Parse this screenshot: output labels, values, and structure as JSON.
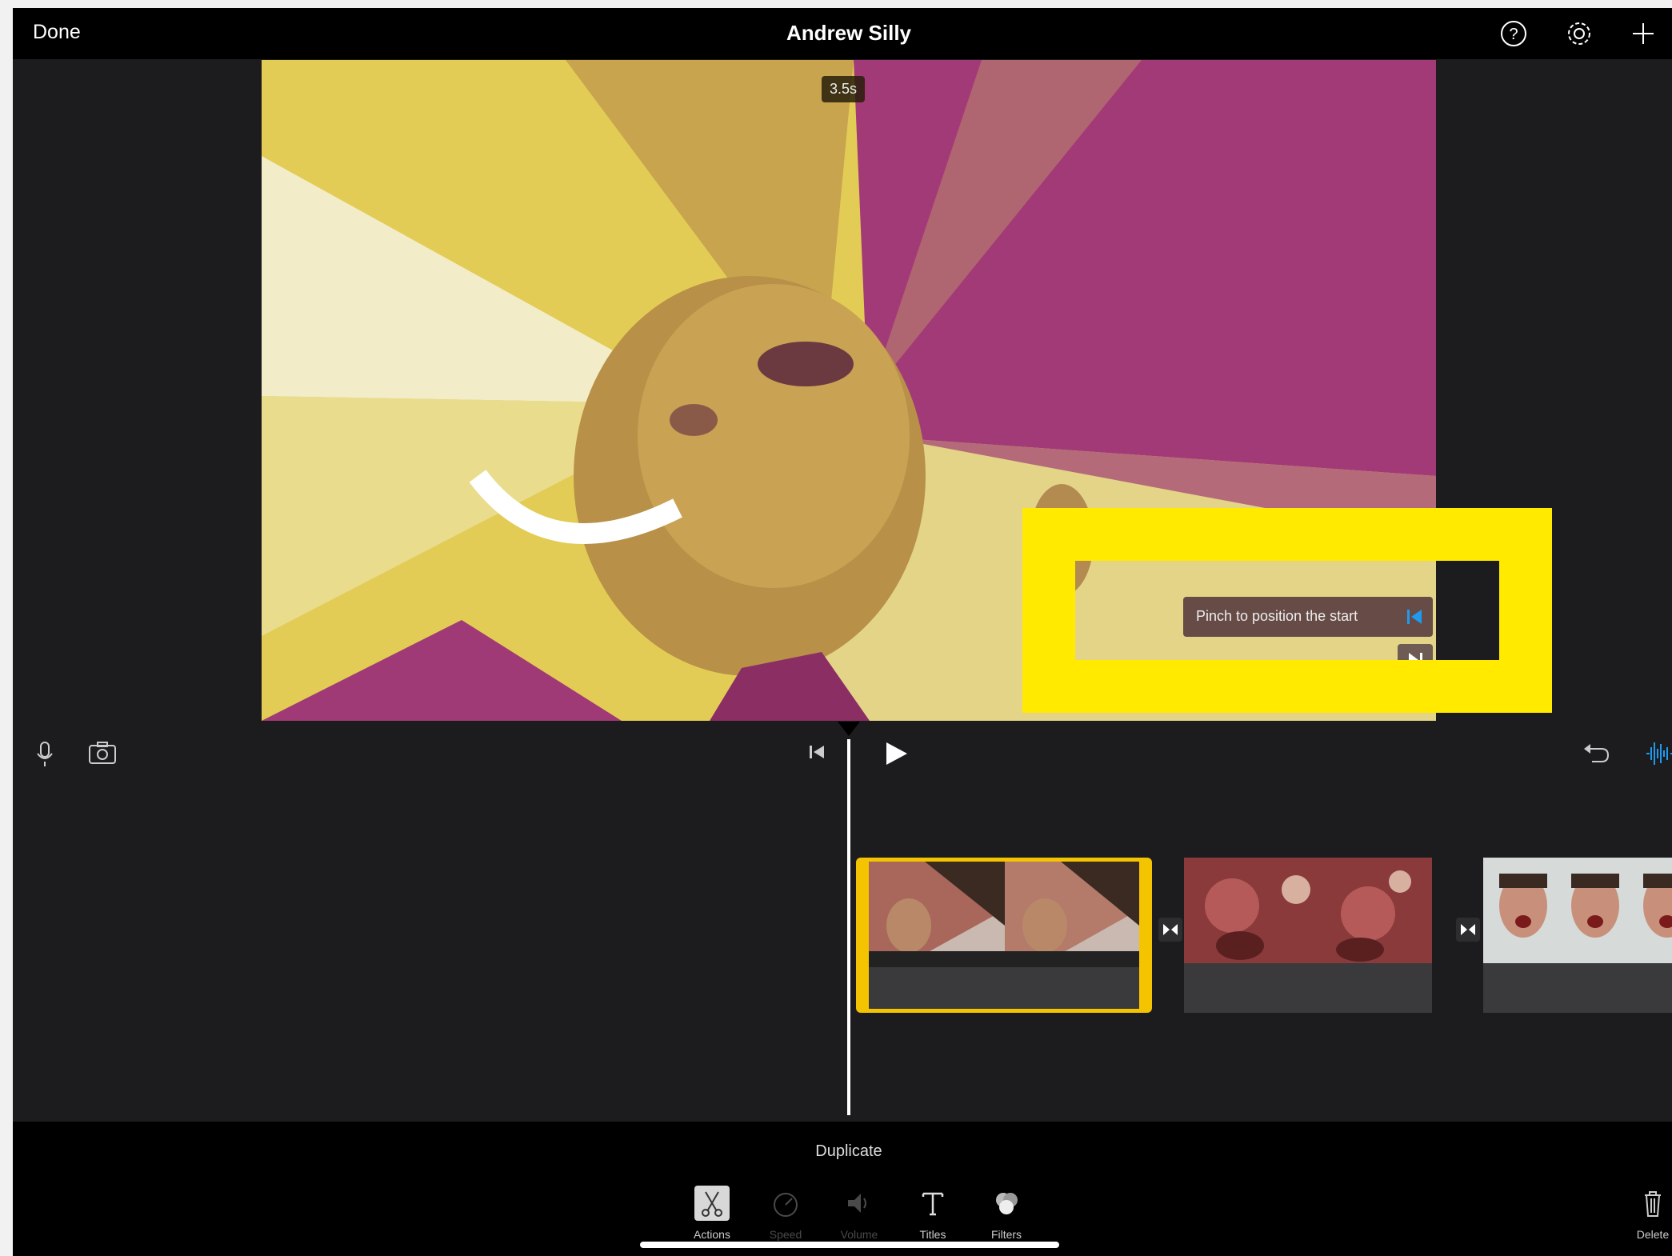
{
  "header": {
    "done_label": "Done",
    "title": "Andrew Silly",
    "icons": [
      "help-icon",
      "settings-icon",
      "add-icon"
    ]
  },
  "viewer": {
    "duration": "3.5s",
    "hint_text": "Pinch to position the start",
    "highlight_color": "#ffea00"
  },
  "timeline": {
    "left_icons": [
      "microphone-icon",
      "camera-icon"
    ],
    "right_icons": [
      "undo-icon",
      "audio-waveform-icon"
    ],
    "clips": [
      "clip-1",
      "clip-2",
      "clip-3"
    ]
  },
  "bottom": {
    "context_label": "Duplicate",
    "tools": [
      {
        "label": "Actions",
        "icon": "scissors-icon",
        "enabled": true,
        "selected": true
      },
      {
        "label": "Speed",
        "icon": "speed-icon",
        "enabled": false
      },
      {
        "label": "Volume",
        "icon": "volume-icon",
        "enabled": false
      },
      {
        "label": "Titles",
        "icon": "titles-icon",
        "enabled": true
      },
      {
        "label": "Filters",
        "icon": "filters-icon",
        "enabled": true
      }
    ],
    "delete_label": "Delete"
  },
  "colors": {
    "accent": "#f5c400",
    "blue": "#1e9bf0"
  }
}
